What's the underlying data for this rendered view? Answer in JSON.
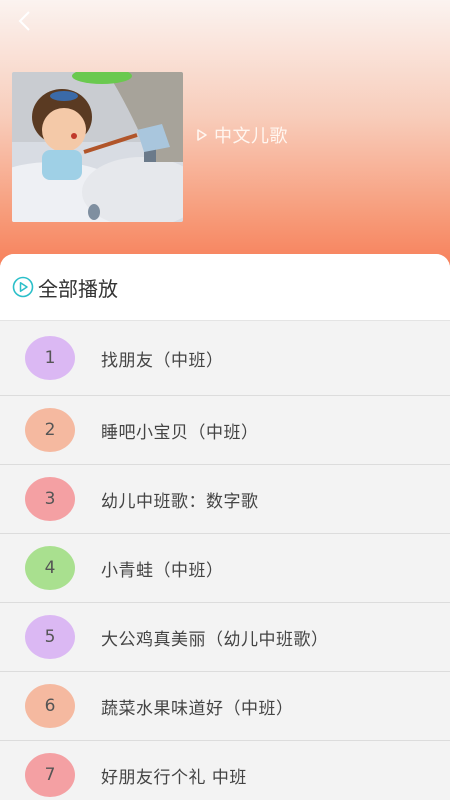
{
  "header": {
    "back_icon": "chevron-left-icon",
    "album_title": "中文儿歌",
    "play_icon": "play-triangle-icon"
  },
  "play_all": {
    "label": "全部播放",
    "icon": "play-circle-icon",
    "accent": "#2bbfc9"
  },
  "tracks": [
    {
      "number": "1",
      "title": "找朋友（中班）",
      "color": "#dbb8f3"
    },
    {
      "number": "2",
      "title": "睡吧小宝贝（中班）",
      "color": "#f5b9a0"
    },
    {
      "number": "3",
      "title": "幼儿中班歌：数字歌",
      "color": "#f4a0a3"
    },
    {
      "number": "4",
      "title": "小青蛙（中班）",
      "color": "#a9e08f"
    },
    {
      "number": "5",
      "title": "大公鸡真美丽（幼儿中班歌）",
      "color": "#dbb8f3"
    },
    {
      "number": "6",
      "title": "蔬菜水果味道好（中班）",
      "color": "#f5b9a0"
    },
    {
      "number": "7",
      "title": "好朋友行个礼 中班",
      "color": "#f4a0a3"
    }
  ]
}
